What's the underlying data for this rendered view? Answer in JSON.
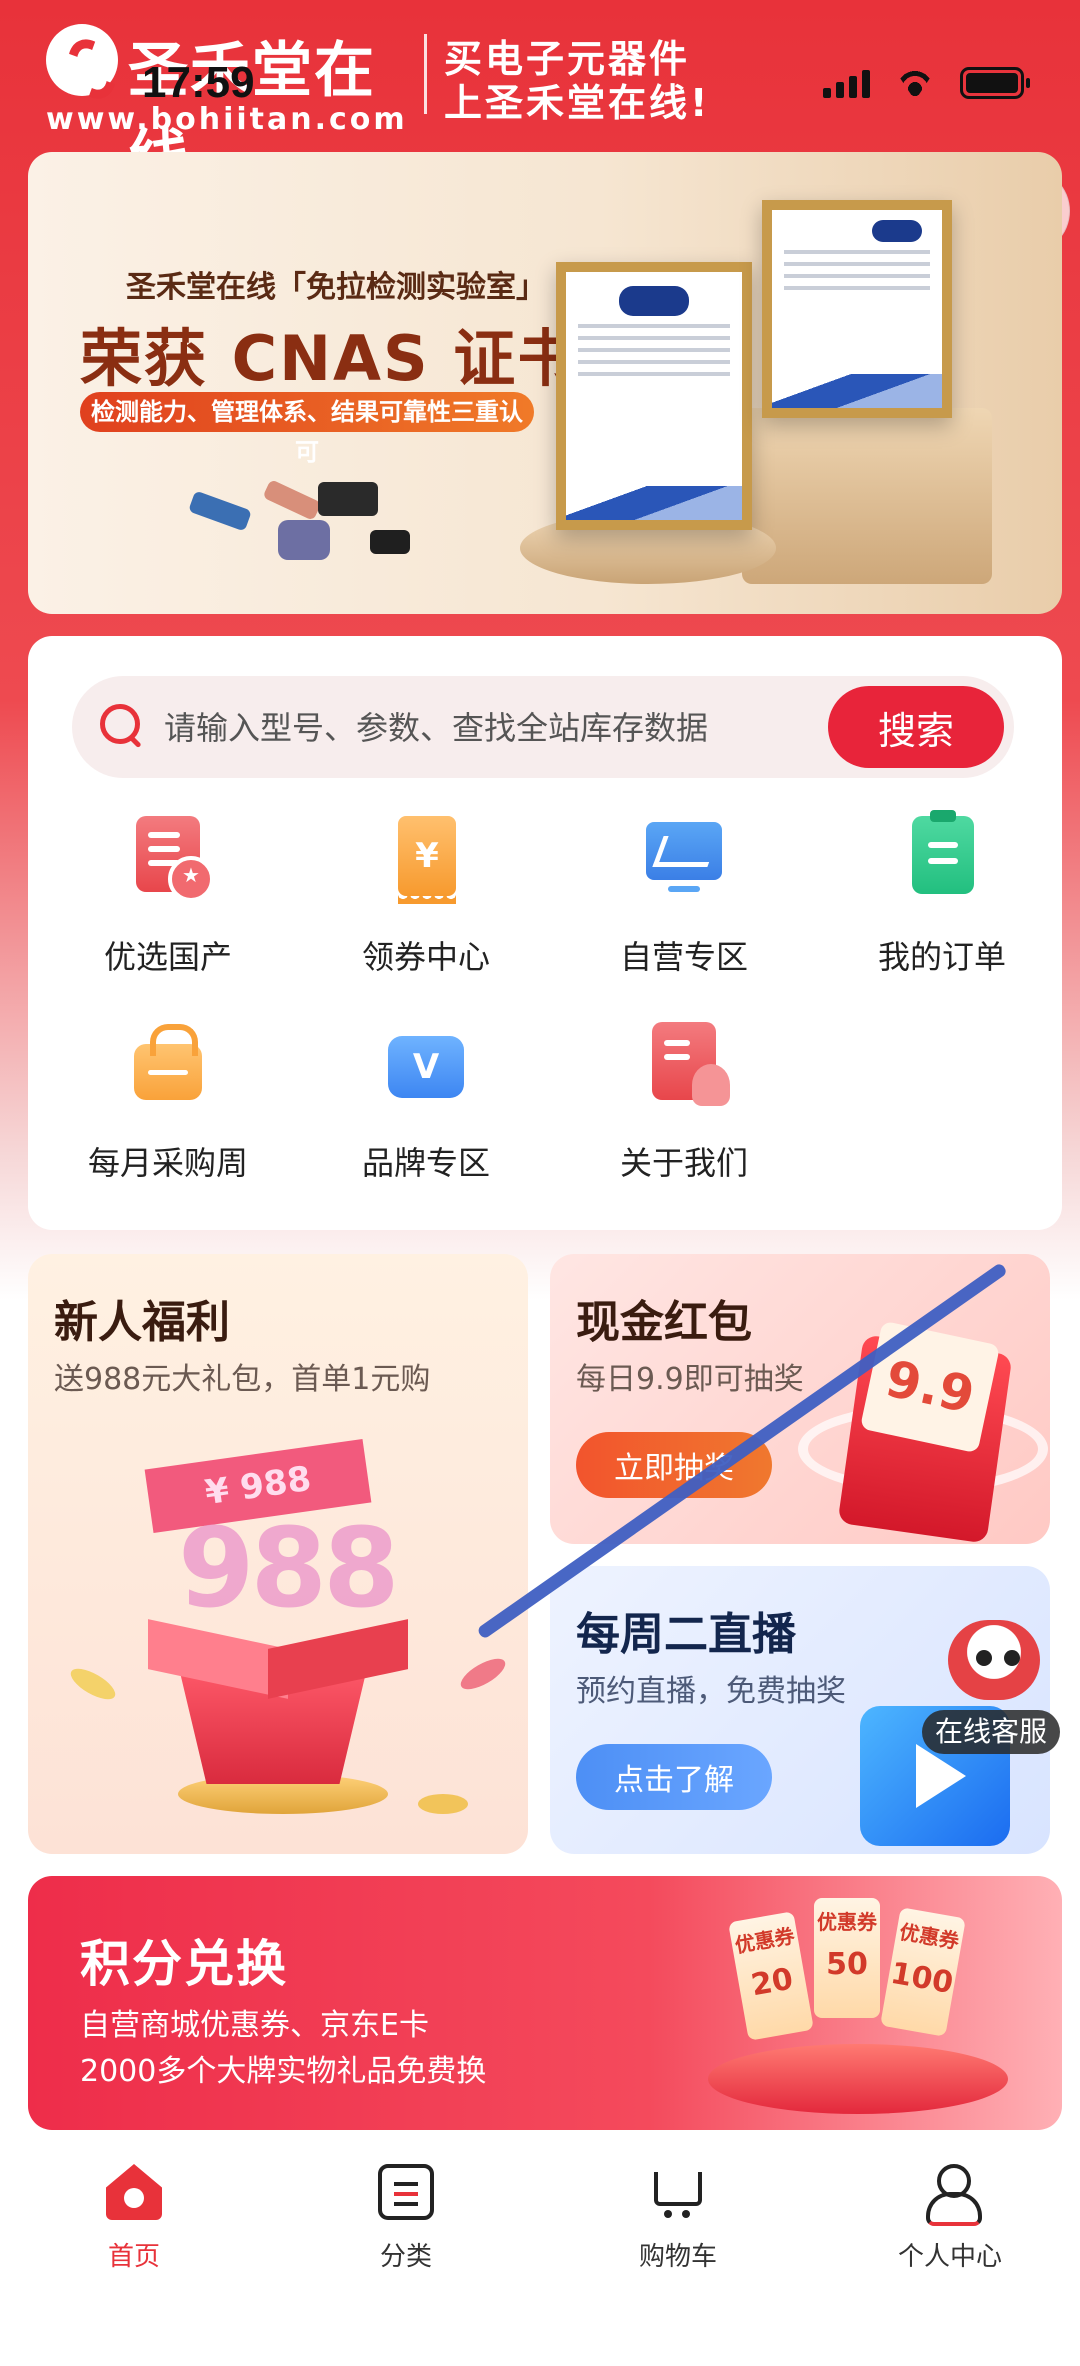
{
  "status_bar": {
    "time": "17:59"
  },
  "header": {
    "brand_name": "圣禾堂在线",
    "brand_url": "www.bohiitan.com",
    "slogan_line1": "买电子元器件",
    "slogan_line2": "上圣禾堂在线!"
  },
  "banner": {
    "small_title": "圣禾堂在线「免拉检测实验室」",
    "title": "荣获 CNAS 证书",
    "pill": "检测能力、管理体系、结果可靠性三重认可"
  },
  "search": {
    "placeholder": "请输入型号、参数、查找全站库存数据",
    "button_label": "搜索"
  },
  "menu": {
    "items": [
      {
        "label": "优选国产",
        "icon": "document-star-icon"
      },
      {
        "label": "领券中心",
        "icon": "coupon-icon"
      },
      {
        "label": "自营专区",
        "icon": "monitor-chart-icon"
      },
      {
        "label": "我的订单",
        "icon": "order-clipboard-icon"
      },
      {
        "label": "每月采购周",
        "icon": "shopping-bag-icon"
      },
      {
        "label": "品牌专区",
        "icon": "brand-v-icon"
      },
      {
        "label": "关于我们",
        "icon": "about-user-icon"
      }
    ]
  },
  "promos": {
    "new_user": {
      "title": "新人福利",
      "subtitle": "送988元大礼包，首单1元购",
      "ribbon": "¥ 988",
      "big_number": "988"
    },
    "red_packet": {
      "title": "现金红包",
      "subtitle": "每日9.9即可抽奖",
      "button": "立即抽奖",
      "card_value": "9.9"
    },
    "live": {
      "title": "每周二直播",
      "subtitle": "预约直播，免费抽奖",
      "button": "点击了解"
    }
  },
  "customer_service": {
    "label": "在线客服"
  },
  "points": {
    "title": "积分兑换",
    "line1": "自营商城优惠券、京东E卡",
    "line2": "2000多个大牌实物礼品免费换",
    "coupons": [
      {
        "tag": "优惠券",
        "value": "20"
      },
      {
        "tag": "优惠券",
        "value": "50"
      },
      {
        "tag": "优惠券",
        "value": "100"
      }
    ]
  },
  "tabbar": {
    "items": [
      {
        "label": "首页",
        "active": true
      },
      {
        "label": "分类",
        "active": false
      },
      {
        "label": "购物车",
        "active": false
      },
      {
        "label": "个人中心",
        "active": false
      }
    ]
  },
  "colors": {
    "brand_red": "#e8323a",
    "accent_blue": "#4d8ff5"
  }
}
